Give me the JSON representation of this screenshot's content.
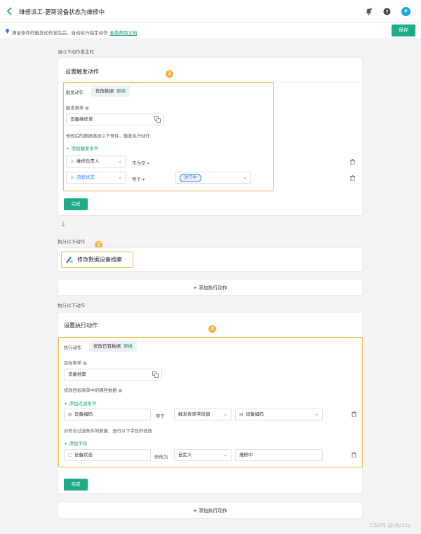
{
  "header": {
    "title": "维修派工-更新设备状态为维修中",
    "avatar_letter": "P"
  },
  "infobar": {
    "text": "满足条件的触发动作发生后，自动执行指定动作",
    "link": "查看帮助文档",
    "save_label": "保存"
  },
  "trigger": {
    "section_label": "当以下动作发生时",
    "card_title": "设置触发动作",
    "badge": "1",
    "action_label": "触发动作",
    "action_value": "修改数据",
    "change_label": "更换",
    "form_label": "触发表单",
    "form_value": "设备维修单",
    "condition_desc": "修改后的数据满足以下条件，触发执行动作",
    "add_condition": "添加触发条件",
    "conditions": [
      {
        "field": "维修负责人",
        "op": "不为空",
        "value": ""
      },
      {
        "field": "流程状态",
        "op": "等于",
        "value": "进行中"
      }
    ],
    "done_label": "完成"
  },
  "execute1": {
    "section_label": "执行以下动作",
    "badge": "2",
    "action_name": "修改数据设备档案",
    "add_action": "添加执行动作"
  },
  "execute2": {
    "section_label": "执行以下动作",
    "card_title": "设置执行动作",
    "badge": "3",
    "action_label": "执行动作",
    "action_value": "修改已有数据",
    "change_label": "更换",
    "target_label": "目标表单",
    "target_value": "设备档案",
    "which_label": "修改目标表单中的哪些数据",
    "add_filter": "添加过滤条件",
    "filter": {
      "field": "设备编码",
      "op": "等于",
      "source": "触发表单字段值",
      "value": "设备编码"
    },
    "modify_desc": "对符合过滤条件的数据，进行以下字段的修改",
    "add_field": "添加字段",
    "assign": {
      "field": "设备状态",
      "op": "修改为",
      "mode": "自定义",
      "value": "维修中"
    },
    "done_label": "完成",
    "add_action": "添加执行动作"
  },
  "watermark": "CSDN @jdyzzy"
}
